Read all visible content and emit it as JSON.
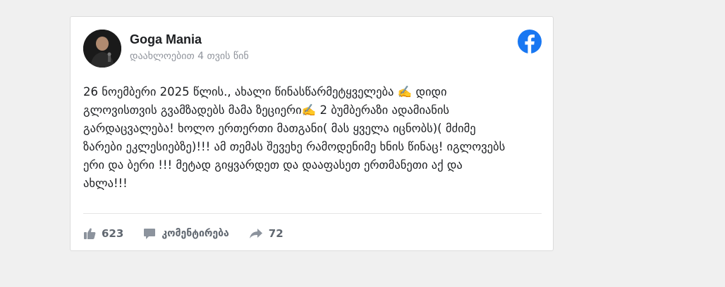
{
  "post": {
    "author": "Goga Mania",
    "timestamp": "დაახლოებით 4 თვის წინ",
    "text": "26 ნოემბერი 2025 წლის., ახალი წინასწარმეტყველება ✍️ დიდი გლოვისთვის გვამზადებს მამა ზეციერი✍️ 2 ბუმბერაზი ადამიანის გარდაცვალება! ხოლო ერთერთი მათგანი( მას ყველა იცნობს)( მძიმე ზარები ეკლესიებზე)!!! ამ თემას შევეხე რამოდენიმე ხნის წინაც! იგლოვებს ერი და ბერი !!! მეტად გიყვარდეთ და დააფასეთ ერთმანეთი აქ და ახლა!!!",
    "platform_icon": "facebook-icon",
    "brand_color": "#1877f2"
  },
  "actions": {
    "likes_count": "623",
    "comment_label": "კომენტირება",
    "shares_count": "72"
  }
}
